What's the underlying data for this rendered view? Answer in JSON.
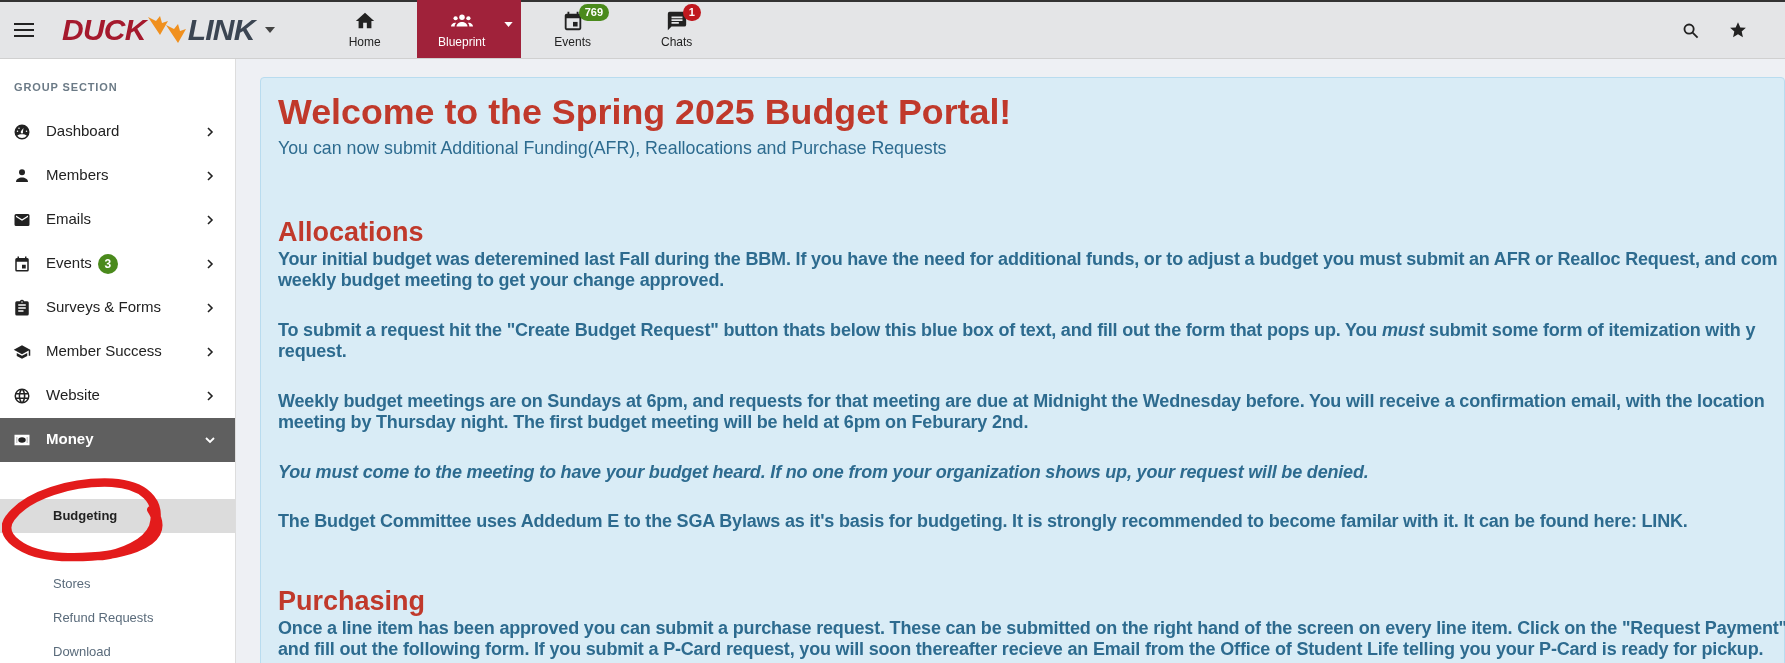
{
  "topbar": {
    "logo": {
      "left": "DUCK",
      "right": "LINK"
    },
    "nav": [
      {
        "label": "Home",
        "selected": false
      },
      {
        "label": "Blueprint",
        "selected": true,
        "dropdown": true
      },
      {
        "label": "Events",
        "selected": false,
        "badge": "769",
        "color": "#4a8a1c"
      },
      {
        "label": "Chats",
        "selected": false,
        "badge": "1",
        "color": "#c0181f"
      }
    ]
  },
  "sidebar": {
    "heading": "GROUP SECTION",
    "items": [
      {
        "label": "Dashboard",
        "expanded": false
      },
      {
        "label": "Members",
        "expanded": false
      },
      {
        "label": "Emails",
        "expanded": false
      },
      {
        "label": "Events",
        "expanded": false,
        "badge": "3"
      },
      {
        "label": "Surveys & Forms",
        "expanded": false
      },
      {
        "label": "Member Success",
        "expanded": false
      },
      {
        "label": "Website",
        "expanded": false
      },
      {
        "label": "Money",
        "expanded": true,
        "children": [
          {
            "label": "Budgeting",
            "selected": true
          },
          {
            "label": "Stores",
            "selected": false
          },
          {
            "label": "Refund Requests",
            "selected": false
          },
          {
            "label": "Download",
            "selected": false
          }
        ]
      }
    ]
  },
  "content": {
    "title": "Welcome to the Spring 2025 Budget Portal!",
    "subtitle": "You can now submit Additional Funding(AFR), Reallocations and Purchase Requests",
    "sections": [
      {
        "heading": "Allocations",
        "paragraphs": [
          {
            "lines": [
              "Your initial budget was deteremined last Fall during the BBM. If you have the need for additional funds, or to adjust a budget you must submit an AFR or Realloc Request, and com",
              "weekly budget meeting to get your change approved."
            ],
            "italic": false
          },
          {
            "lines": [
              "To submit a request hit the \"Create Budget Request\" button thats below this blue box of text, and fill out the form that pops up. You *must* submit some form of itemization with y",
              "request."
            ],
            "italic": false
          },
          {
            "lines": [
              "Weekly budget meetings are on Sundays at 6pm, and requests for that meeting are due at Midnight the Wednesday before. You will receive a confirmation email, with the location",
              "meeting by Thursday night. The first budget meeting will be held at 6pm on Feburary 2nd."
            ],
            "italic": false
          },
          {
            "lines": [
              "You must come to the meeting to have your budget heard. If no one from your organization shows up, your request will be denied."
            ],
            "italic": true
          },
          {
            "lines": [
              "The Budget Committee uses Addedum E to the SGA Bylaws as it's basis for budgeting. It is strongly recommended to become familar with it. It can be found here: LINK."
            ],
            "italic": false
          }
        ]
      },
      {
        "heading": "Purchasing",
        "paragraphs": [
          {
            "lines": [
              "Once a line item has been approved you can submit a purchase request. These can be submitted on the right hand of the screen on every line item. Click on the \"Request Payment\"",
              "and fill out the following form. If you submit a P-Card request, you will soon thereafter recieve an Email from the Office of Student Life telling you your P-Card is ready for pickup."
            ],
            "italic": false
          }
        ]
      }
    ]
  }
}
